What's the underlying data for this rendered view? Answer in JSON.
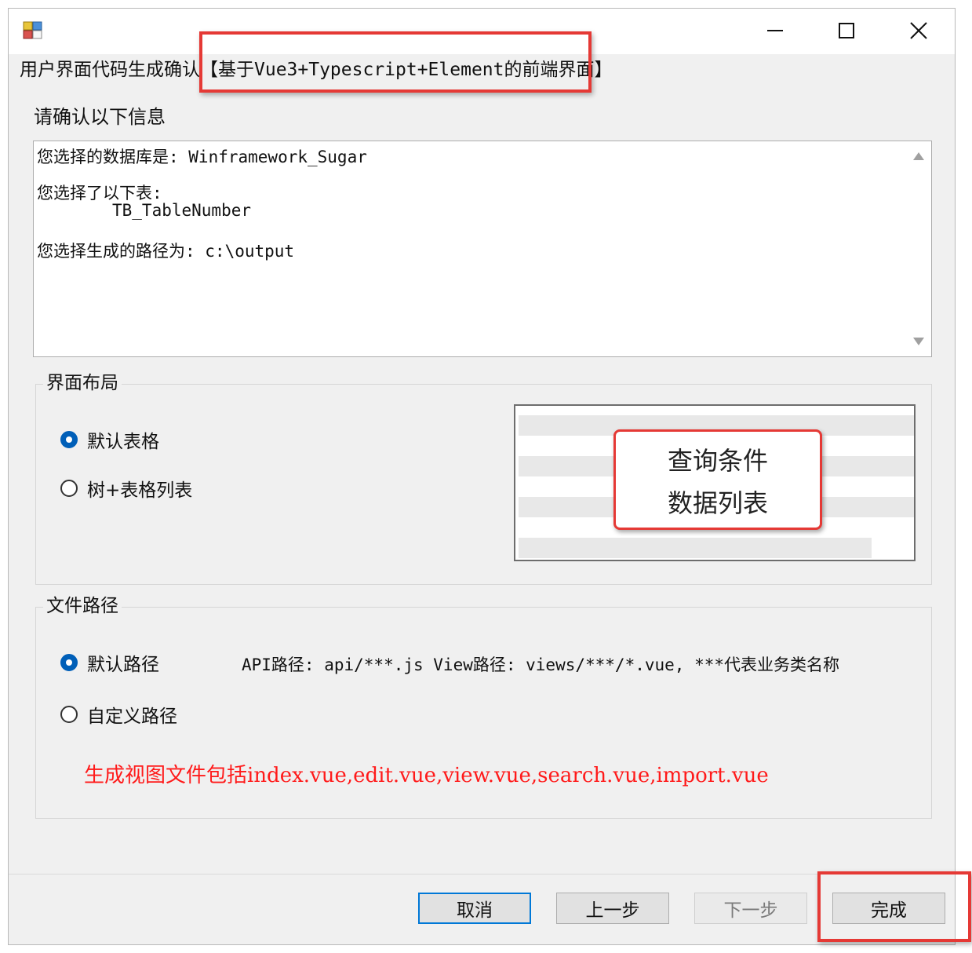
{
  "window": {
    "caption_prefix": "用户界面代码生成确认",
    "caption_highlight": "【基于Vue3+Typescript+Element的前端界面】"
  },
  "summary": {
    "label": "请确认以下信息",
    "line1": "您选择的数据库是: Winframework_Sugar",
    "line2": "您选择了以下表:",
    "line3": "TB_TableNumber",
    "line4": "您选择生成的路径为: c:\\output"
  },
  "layout_group": {
    "title": "界面布局",
    "options": [
      {
        "label": "默认表格",
        "selected": true
      },
      {
        "label": "树+表格列表",
        "selected": false
      }
    ],
    "preview": {
      "line1": "查询条件",
      "line2": "数据列表"
    }
  },
  "path_group": {
    "title": "文件路径",
    "options": [
      {
        "label": "默认路径",
        "selected": true
      },
      {
        "label": "自定义路径",
        "selected": false
      }
    ],
    "hint": "API路径: api/***.js  View路径: views/***/*.vue, ***代表业务类名称",
    "note": "生成视图文件包括index.vue,edit.vue,view.vue,search.vue,import.vue"
  },
  "buttons": {
    "cancel": "取消",
    "prev": "上一步",
    "next": "下一步",
    "finish": "完成"
  },
  "colors": {
    "highlight": "#e53935",
    "note_text": "#ff1a1a",
    "accent": "#005fb8"
  },
  "icons": [
    "app-icon",
    "minimize-icon",
    "maximize-icon",
    "close-icon",
    "scroll-up-icon",
    "scroll-down-icon"
  ]
}
